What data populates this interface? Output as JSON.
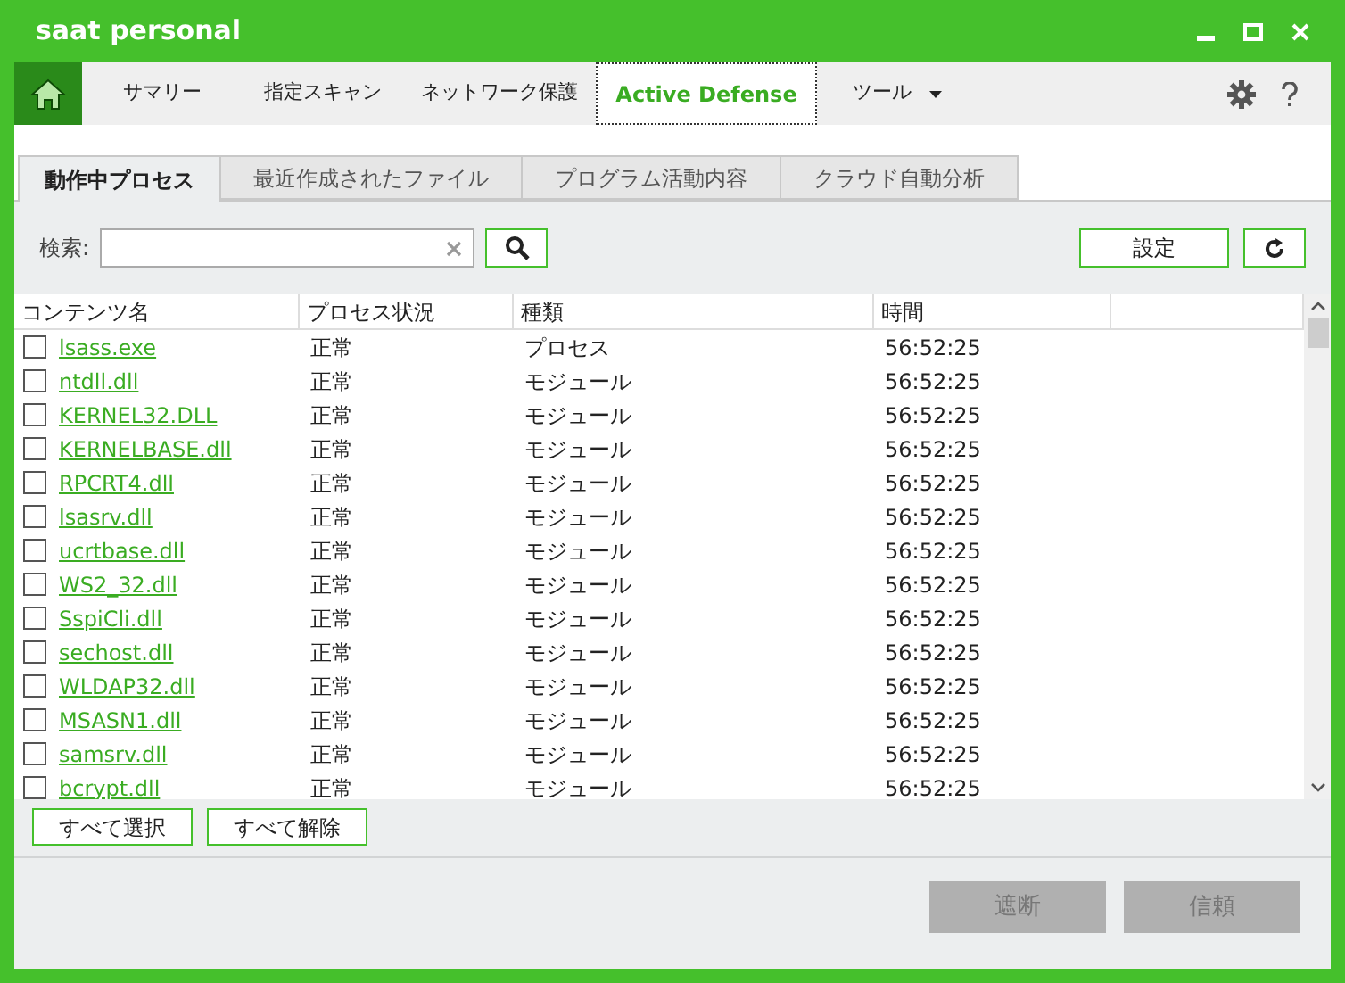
{
  "window": {
    "title": "saat personal"
  },
  "nav": [
    {
      "label": "サマリー",
      "selected": false,
      "kind": "tab"
    },
    {
      "label": "指定スキャン",
      "selected": false,
      "kind": "tab"
    },
    {
      "label": "ネットワーク保護",
      "selected": false,
      "kind": "tab"
    },
    {
      "label": "Active Defense",
      "selected": true,
      "kind": "tab"
    },
    {
      "label": "ツール",
      "selected": false,
      "kind": "menu"
    }
  ],
  "subtabs": [
    {
      "label": "動作中プロセス",
      "selected": true
    },
    {
      "label": "最近作成されたファイル",
      "selected": false
    },
    {
      "label": "プログラム活動内容",
      "selected": false
    },
    {
      "label": "クラウド自動分析",
      "selected": false
    }
  ],
  "search": {
    "label": "検索:",
    "settings_button": "設定"
  },
  "table": {
    "columns": [
      "コンテンツ名",
      "プロセス状況",
      "種類",
      "時間"
    ],
    "rows": [
      {
        "name": "lsass.exe",
        "status": "正常",
        "type": "プロセス",
        "time": "56:52:25",
        "checked": false
      },
      {
        "name": "ntdll.dll",
        "status": "正常",
        "type": "モジュール",
        "time": "56:52:25",
        "checked": false
      },
      {
        "name": "KERNEL32.DLL",
        "status": "正常",
        "type": "モジュール",
        "time": "56:52:25",
        "checked": false
      },
      {
        "name": "KERNELBASE.dll",
        "status": "正常",
        "type": "モジュール",
        "time": "56:52:25",
        "checked": false
      },
      {
        "name": "RPCRT4.dll",
        "status": "正常",
        "type": "モジュール",
        "time": "56:52:25",
        "checked": false
      },
      {
        "name": "lsasrv.dll",
        "status": "正常",
        "type": "モジュール",
        "time": "56:52:25",
        "checked": false
      },
      {
        "name": "ucrtbase.dll",
        "status": "正常",
        "type": "モジュール",
        "time": "56:52:25",
        "checked": false
      },
      {
        "name": "WS2_32.dll",
        "status": "正常",
        "type": "モジュール",
        "time": "56:52:25",
        "checked": false
      },
      {
        "name": "SspiCli.dll",
        "status": "正常",
        "type": "モジュール",
        "time": "56:52:25",
        "checked": false
      },
      {
        "name": "sechost.dll",
        "status": "正常",
        "type": "モジュール",
        "time": "56:52:25",
        "checked": false
      },
      {
        "name": "WLDAP32.dll",
        "status": "正常",
        "type": "モジュール",
        "time": "56:52:25",
        "checked": false
      },
      {
        "name": "MSASN1.dll",
        "status": "正常",
        "type": "モジュール",
        "time": "56:52:25",
        "checked": false
      },
      {
        "name": "samsrv.dll",
        "status": "正常",
        "type": "モジュール",
        "time": "56:52:25",
        "checked": false
      },
      {
        "name": "bcrypt.dll",
        "status": "正常",
        "type": "モジュール",
        "time": "56:52:25",
        "checked": false
      }
    ]
  },
  "select_buttons": [
    "すべて選択",
    "すべて解除"
  ],
  "actions": [
    {
      "label": "遮断",
      "disabled": true
    },
    {
      "label": "信頼",
      "disabled": true
    }
  ]
}
